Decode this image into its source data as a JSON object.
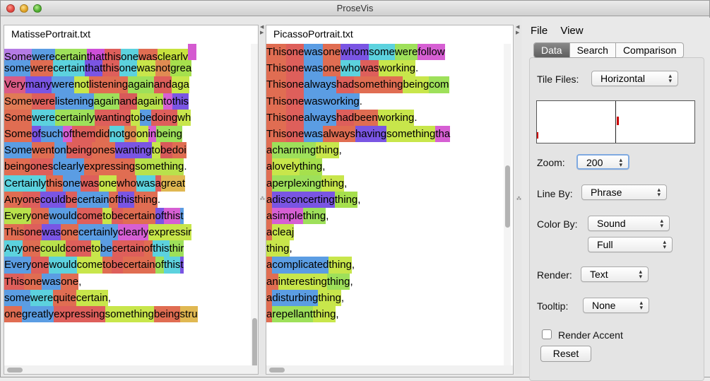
{
  "app": {
    "title": "ProseVis"
  },
  "menu": {
    "file": "File",
    "view": "View"
  },
  "panes": [
    {
      "file_name": "MatissePortrait.txt",
      "lines": [
        [
          [
            "Some",
            "#b57be6"
          ],
          [
            " were ",
            "#5b9de3"
          ],
          [
            "certain",
            "#9ee05a"
          ],
          [
            " that ",
            "#cd4fd8"
          ],
          [
            "this ",
            "#de5f5b"
          ],
          [
            "one ",
            "#5cd2de"
          ],
          [
            "was ",
            "#e06d52"
          ],
          [
            "clearly",
            "#c7e23d"
          ],
          [
            "",
            "#d45ad0"
          ]
        ],
        [
          [
            "some ",
            "#5b9de3"
          ],
          [
            "were ",
            "#e06d52"
          ],
          [
            "certain ",
            "#5cd2de"
          ],
          [
            "that ",
            "#7a55e3"
          ],
          [
            "this ",
            "#de5f5b"
          ],
          [
            "one ",
            "#5cd2de"
          ],
          [
            "was ",
            "#c8e64b"
          ],
          [
            "not ",
            "#e08b52"
          ],
          [
            "grea",
            "#a6e04d"
          ]
        ],
        [
          [
            "Very ",
            "#da5b86"
          ],
          [
            "many ",
            "#7a55e3"
          ],
          [
            "were ",
            "#5b9de3"
          ],
          [
            "not ",
            "#c8e64b"
          ],
          [
            "listening ",
            "#e06d52"
          ],
          [
            "again ",
            "#9ee05a"
          ],
          [
            "and ",
            "#de5f5b"
          ],
          [
            "aga",
            "#c8e64b"
          ]
        ],
        [
          [
            "Some ",
            "#e07a55"
          ],
          [
            "were ",
            "#de5f5b"
          ],
          [
            "listening ",
            "#5b9de3"
          ],
          [
            "again ",
            "#9ee05a"
          ],
          [
            "and ",
            "#d85a5a"
          ],
          [
            "again ",
            "#b9e14c"
          ],
          [
            "to ",
            "#d65fd3"
          ],
          [
            "this",
            "#7a55e3"
          ]
        ],
        [
          [
            "Some ",
            "#e06d52"
          ],
          [
            "were ",
            "#5cd2de"
          ],
          [
            "certainly ",
            "#9ee05a"
          ],
          [
            "wanting ",
            "#de5f5b"
          ],
          [
            "to ",
            "#c8e64b"
          ],
          [
            "be ",
            "#5b9de3"
          ],
          [
            "doing ",
            "#de5f5b"
          ],
          [
            "wh",
            "#c8e64b"
          ]
        ],
        [
          [
            "Some ",
            "#e06d52"
          ],
          [
            "of ",
            "#7a55e3"
          ],
          [
            "such ",
            "#5b9de3"
          ],
          [
            "of ",
            "#d65fd3"
          ],
          [
            "them ",
            "#de5f5b"
          ],
          [
            "did ",
            "#e06d52"
          ],
          [
            "not ",
            "#5cd2de"
          ],
          [
            "go ",
            "#e08b52"
          ],
          [
            "on ",
            "#c8e64b"
          ],
          [
            "in ",
            "#d65fd3"
          ],
          [
            "being",
            "#9ee05a"
          ]
        ],
        [
          [
            "Some ",
            "#5b9de3"
          ],
          [
            "went ",
            "#e06d52"
          ],
          [
            "on ",
            "#5b9de3"
          ],
          [
            "being ",
            "#de5f5b"
          ],
          [
            "ones ",
            "#e06d52"
          ],
          [
            "wanting ",
            "#7a55e3"
          ],
          [
            "to ",
            "#c8e64b"
          ],
          [
            "be ",
            "#d85a5a"
          ],
          [
            "doi",
            "#e06d52"
          ]
        ],
        [
          [
            "being ",
            "#e06d52"
          ],
          [
            "ones ",
            "#de5f5b"
          ],
          [
            "clearly ",
            "#5b9de3"
          ],
          [
            "expressing ",
            "#e06d52"
          ],
          [
            "something ",
            "#b9e14c"
          ],
          [
            ". ",
            "#ffffff"
          ]
        ],
        [
          [
            "Certainly ",
            "#5cd2de"
          ],
          [
            "this ",
            "#e06d52"
          ],
          [
            "one ",
            "#5b9de3"
          ],
          [
            "was ",
            "#de5f5b"
          ],
          [
            "one ",
            "#c8e64b"
          ],
          [
            "who ",
            "#e06d52"
          ],
          [
            "was ",
            "#5cd2de"
          ],
          [
            "a ",
            "#de5f5b"
          ],
          [
            "great",
            "#e0b852"
          ]
        ],
        [
          [
            "Any ",
            "#e06d52"
          ],
          [
            "one ",
            "#de5f5b"
          ],
          [
            "could ",
            "#7a55e3"
          ],
          [
            "be ",
            "#de5f5b"
          ],
          [
            "certain ",
            "#5b9de3"
          ],
          [
            "of ",
            "#e06d52"
          ],
          [
            "this ",
            "#7a55e3"
          ],
          [
            "thing ",
            "#e06d52"
          ],
          [
            ". ",
            "#ffffff"
          ]
        ],
        [
          [
            "Every ",
            "#b9e14c"
          ],
          [
            "one ",
            "#e06d52"
          ],
          [
            "would ",
            "#5b9de3"
          ],
          [
            "come ",
            "#de5f5b"
          ],
          [
            "to ",
            "#c8e64b"
          ],
          [
            "be ",
            "#de5f5b"
          ],
          [
            "certain ",
            "#e06d52"
          ],
          [
            "of ",
            "#7a55e3"
          ],
          [
            "this ",
            "#d65fd3"
          ],
          [
            "t",
            "#5b9de3"
          ]
        ],
        [
          [
            "This ",
            "#e06d52"
          ],
          [
            "one ",
            "#de5f5b"
          ],
          [
            "was ",
            "#7a55e3"
          ],
          [
            "one ",
            "#e06d52"
          ],
          [
            "certainly ",
            "#5b9de3"
          ],
          [
            "clearly ",
            "#d65fd3"
          ],
          [
            "expressir",
            "#c8e64b"
          ]
        ],
        [
          [
            "Any ",
            "#5cd2de"
          ],
          [
            "one ",
            "#e06d52"
          ],
          [
            "could ",
            "#b9e14c"
          ],
          [
            "come ",
            "#de5f5b"
          ],
          [
            "to ",
            "#c8e64b"
          ],
          [
            "be ",
            "#5b9de3"
          ],
          [
            "certain ",
            "#de5f5b"
          ],
          [
            "of ",
            "#e06d52"
          ],
          [
            "this ",
            "#5cd2de"
          ],
          [
            "thir",
            "#9ee05a"
          ]
        ],
        [
          [
            "Every ",
            "#5b9de3"
          ],
          [
            "one ",
            "#de5f5b"
          ],
          [
            "would ",
            "#5cd2de"
          ],
          [
            "come ",
            "#c8e64b"
          ],
          [
            "to ",
            "#e06d52"
          ],
          [
            "be ",
            "#de5f5b"
          ],
          [
            "certain ",
            "#e06d52"
          ],
          [
            "of ",
            "#9ee05a"
          ],
          [
            "this ",
            "#5cd2de"
          ],
          [
            "t",
            "#7a55e3"
          ]
        ],
        [
          [
            "This ",
            "#de5f5b"
          ],
          [
            "one ",
            "#e06d52"
          ],
          [
            "was ",
            "#5b9de3"
          ],
          [
            "one ",
            "#e06d52"
          ],
          [
            ", ",
            "#ffffff"
          ]
        ],
        [
          [
            "some ",
            "#5b9de3"
          ],
          [
            "were ",
            "#5cd2de"
          ],
          [
            "quite ",
            "#e06d52"
          ],
          [
            "certain ",
            "#c8e64b"
          ],
          [
            ", ",
            "#ffffff"
          ]
        ],
        [
          [
            "one ",
            "#e06d52"
          ],
          [
            "greatly ",
            "#5b9de3"
          ],
          [
            "expressing ",
            "#de5f5b"
          ],
          [
            "something ",
            "#c8e64b"
          ],
          [
            "being ",
            "#e06d52"
          ],
          [
            "stru",
            "#e0b852"
          ]
        ]
      ]
    },
    {
      "file_name": "PicassoPortrait.txt",
      "lines": [
        [
          [
            "This ",
            "#e06d52"
          ],
          [
            "one ",
            "#de5f5b"
          ],
          [
            "was ",
            "#5b9de3"
          ],
          [
            "one ",
            "#e06d52"
          ],
          [
            "whom ",
            "#7a55e3"
          ],
          [
            "some ",
            "#5cd2de"
          ],
          [
            "were ",
            "#9ee05a"
          ],
          [
            "follow",
            "#d65fd3"
          ]
        ],
        [
          [
            "This ",
            "#e06d52"
          ],
          [
            "one ",
            "#de5f5b"
          ],
          [
            "was ",
            "#5b9de3"
          ],
          [
            "one ",
            "#e06d52"
          ],
          [
            "who ",
            "#5cd2de"
          ],
          [
            "was ",
            "#de5f5b"
          ],
          [
            "working ",
            "#c8e64b"
          ],
          [
            ". ",
            "#ffffff"
          ]
        ],
        [
          [
            "This ",
            "#e06d52"
          ],
          [
            "one ",
            "#de5f5b"
          ],
          [
            "always ",
            "#5b9de3"
          ],
          [
            "had ",
            "#de5f5b"
          ],
          [
            "something ",
            "#e06d52"
          ],
          [
            "being ",
            "#c8e64b"
          ],
          [
            "com",
            "#9ee05a"
          ]
        ],
        [
          [
            "This ",
            "#e06d52"
          ],
          [
            "one ",
            "#de5f5b"
          ],
          [
            "was ",
            "#5b9de3"
          ],
          [
            "working ",
            "#5b9de3"
          ],
          [
            ". ",
            "#ffffff"
          ]
        ],
        [
          [
            "This ",
            "#e06d52"
          ],
          [
            "one ",
            "#de5f5b"
          ],
          [
            "always ",
            "#5b9de3"
          ],
          [
            "had ",
            "#de5f5b"
          ],
          [
            "been ",
            "#e06d52"
          ],
          [
            "working ",
            "#c8e64b"
          ],
          [
            ". ",
            "#ffffff"
          ]
        ],
        [
          [
            "This ",
            "#e06d52"
          ],
          [
            "one ",
            "#de5f5b"
          ],
          [
            "was ",
            "#5b9de3"
          ],
          [
            "always ",
            "#e06d52"
          ],
          [
            "having ",
            "#7a55e3"
          ],
          [
            "something ",
            "#c8e64b"
          ],
          [
            "tha",
            "#d65fd3"
          ]
        ],
        [
          [
            "a ",
            "#e06d52"
          ],
          [
            "charming ",
            "#9ee05a"
          ],
          [
            "thing ",
            "#c8e64b"
          ],
          [
            ", ",
            "#ffffff"
          ]
        ],
        [
          [
            "a ",
            "#e06d52"
          ],
          [
            "lovely ",
            "#c8e64b"
          ],
          [
            "thing ",
            "#a6e04d"
          ],
          [
            ", ",
            "#ffffff"
          ]
        ],
        [
          [
            "a ",
            "#e06d52"
          ],
          [
            "perplexing ",
            "#9ee05a"
          ],
          [
            "thing ",
            "#c8e64b"
          ],
          [
            ", ",
            "#ffffff"
          ]
        ],
        [
          [
            "a ",
            "#e06d52"
          ],
          [
            "disconcerting ",
            "#7a55e3"
          ],
          [
            "thing ",
            "#a6e04d"
          ],
          [
            ", ",
            "#ffffff"
          ]
        ],
        [
          [
            "a ",
            "#e06d52"
          ],
          [
            "simple ",
            "#d65fd3"
          ],
          [
            "thing ",
            "#9ee05a"
          ],
          [
            ", ",
            "#ffffff"
          ]
        ],
        [
          [
            "a ",
            "#e06d52"
          ],
          [
            "cleaj",
            "#c8e64b"
          ]
        ],
        [
          [
            "thing ",
            "#c8e64b"
          ],
          [
            ", ",
            "#ffffff"
          ]
        ],
        [
          [
            "a ",
            "#e06d52"
          ],
          [
            "complicated ",
            "#5b9de3"
          ],
          [
            "thing ",
            "#c8e64b"
          ],
          [
            ", ",
            "#ffffff"
          ]
        ],
        [
          [
            "an ",
            "#e06d52"
          ],
          [
            "interesting ",
            "#c8e64b"
          ],
          [
            "thing ",
            "#9ee05a"
          ],
          [
            ", ",
            "#ffffff"
          ]
        ],
        [
          [
            "a ",
            "#e06d52"
          ],
          [
            "disturbing ",
            "#5b9de3"
          ],
          [
            "thing ",
            "#c8e64b"
          ],
          [
            ", ",
            "#ffffff"
          ]
        ],
        [
          [
            "a ",
            "#e06d52"
          ],
          [
            "repellant ",
            "#9ee05a"
          ],
          [
            "thing ",
            "#c8e64b"
          ],
          [
            ", ",
            "#ffffff"
          ]
        ]
      ]
    }
  ],
  "controls": {
    "tabs": [
      "Data",
      "Search",
      "Comparison"
    ],
    "active_tab": "Data",
    "tile_files_label": "Tile Files:",
    "tile_files_value": "Horizontal",
    "zoom_label": "Zoom:",
    "zoom_value": "200",
    "line_by_label": "Line By:",
    "line_by_value": "Phrase",
    "color_by_label": "Color By:",
    "color_by_value": "Sound",
    "color_by_detail": "Full",
    "render_label": "Render:",
    "render_value": "Text",
    "tooltip_label": "Tooltip:",
    "tooltip_value": "None",
    "render_accent_label": "Render Accent",
    "render_accent_checked": false,
    "reset_label": "Reset"
  }
}
